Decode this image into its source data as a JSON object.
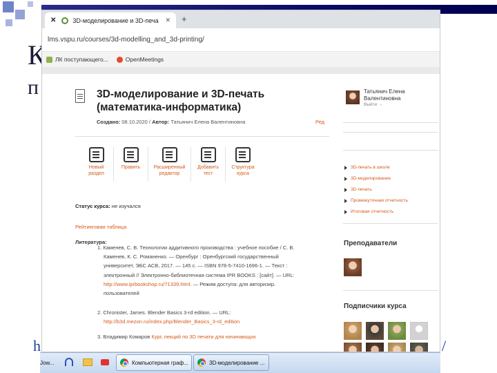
{
  "slide": {
    "bg_text_1": "К",
    "bg_text_2": "п",
    "bg_url_start": "h",
    "bg_url_end": "/"
  },
  "browser": {
    "tab_title": "3D-моделирование и 3D-печа",
    "address": "lms.vspu.ru/courses/3d-modelling_and_3d-printing/",
    "bookmarks": [
      "ЛК поступающего...",
      "OpenMeetings"
    ]
  },
  "course": {
    "title": "3D-моделирование и 3D-печать (математика-информатика)",
    "created_label": "Создано:",
    "created_value": "08.10.2020",
    "author_label": "Автор:",
    "author_value": "Татьянич Елена Валентиновна",
    "edit_link": "Ред",
    "tools": [
      {
        "label": "Новый раздел",
        "icon": "new-section-icon"
      },
      {
        "label": "Править",
        "icon": "edit-icon"
      },
      {
        "label": "Расширенный редактор",
        "icon": "advanced-editor-icon"
      },
      {
        "label": "Добавить тест",
        "icon": "add-test-icon"
      },
      {
        "label": "Структура курса",
        "icon": "course-structure-icon"
      }
    ],
    "status_label": "Статус курса:",
    "status_value": "не изучался",
    "rating_link": "Рейтинговая таблица",
    "literature_title": "Литература:",
    "lit1_lines": [
      "1. Каменев, С. В. Технологии аддитивного производства : учебное пособие / С. В.",
      "Каменев, К. С. Романенко. — Оренбург : Оренбургский государственный",
      "университет, ЭБС АСВ, 2017. — 145 с. — ISBN 978-5-7410-1696-1. — Текст :",
      "электронный // Электронно-библиотечная система IPR BOOKS : [сайт]. — URL:"
    ],
    "lit1_link": "http://www.iprbookshop.ru/71339.html",
    "lit1_after": ". — Режим доступа: для авторизир.",
    "lit1_last": "пользователей",
    "lit2_line": "2. Chronister, James.  Blender Basics 3-rd edition. — URL:",
    "lit2_link": "http://b3d.mezon.ru/index.php/Blender_Basics_3-rd_edition",
    "lit3_prefix": "3. Владимир Комаров ",
    "lit3_link": "Курс лекций по 3D печати для начинающих"
  },
  "sidebar": {
    "user_name_1": "Татьянич Елена",
    "user_name_2": "Валентиновна",
    "logout": "Выйти  →",
    "nav": [
      "3D-печать в школе",
      "3D-моделирование",
      "3D-печать",
      "Промежуточная отчетность",
      "Итоговая отчетность"
    ],
    "teachers_title": "Преподаватели",
    "subscribers_title": "Подписчики курса"
  },
  "taskbar": {
    "left_fragment": "Jow...",
    "task1": "Компьютерная граф...",
    "task2": "3D-моделирование ..."
  },
  "colors": {
    "accent": "#d45a1a",
    "text": "#333333"
  }
}
